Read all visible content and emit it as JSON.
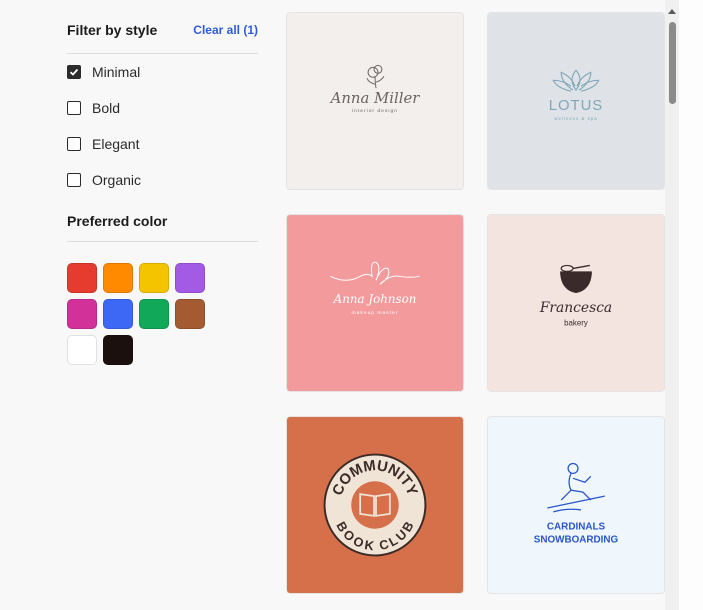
{
  "filter": {
    "title": "Filter by style",
    "clear_label": "Clear all (1)",
    "options": [
      {
        "label": "Minimal",
        "checked": true
      },
      {
        "label": "Bold",
        "checked": false
      },
      {
        "label": "Elegant",
        "checked": false
      },
      {
        "label": "Organic",
        "checked": false
      }
    ]
  },
  "color": {
    "title": "Preferred color",
    "swatches": [
      "#e63c2f",
      "#ff8a00",
      "#f5c400",
      "#a35be6",
      "#d2319a",
      "#3d68f5",
      "#12a85a",
      "#a45b32",
      "#ffffff",
      "#1c100e"
    ]
  },
  "cards": [
    {
      "name": "Anna Miller",
      "sub": "interior design",
      "bg": "#f2efed",
      "color": "#6a6361"
    },
    {
      "name": "LOTUS",
      "sub": "wellness & spa",
      "bg": "#dfe3e7",
      "color": "#7fa6b8"
    },
    {
      "name": "Anna Johnson",
      "sub": "makeup master",
      "bg": "#f29a9c",
      "color": "#ffffff"
    },
    {
      "name": "Francesca",
      "sub": "bakery",
      "bg": "#f3e4e0",
      "color": "#3b2a2a"
    },
    {
      "name": "COMMUNITY",
      "sub": "BOOK CLUB",
      "bg": "#d6704a",
      "color": "#3b2a26"
    },
    {
      "name": "CARDINALS",
      "sub": "SNOWBOARDING",
      "bg": "#eff7fd",
      "color": "#2a55c9"
    }
  ]
}
